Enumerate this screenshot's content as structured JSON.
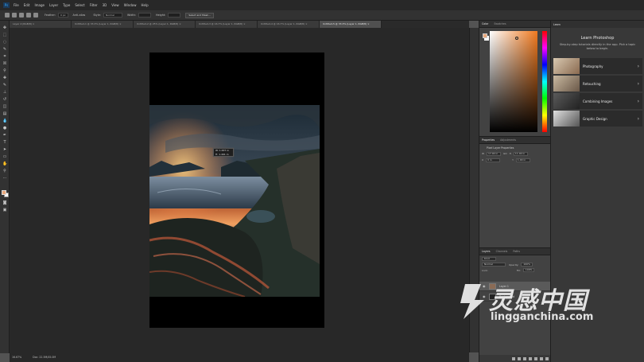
{
  "app": {
    "logo": "Ps"
  },
  "menu": [
    "File",
    "Edit",
    "Image",
    "Layer",
    "Type",
    "Select",
    "Filter",
    "3D",
    "View",
    "Window",
    "Help"
  ],
  "options": {
    "feather_label": "Feather:",
    "feather_value": "0 px",
    "antialias_label": "Anti-alias",
    "style_label": "Style:",
    "style_value": "Normal",
    "width_label": "Width:",
    "height_label": "Height:",
    "select_mask_button": "Select and Mask..."
  },
  "tabs": [
    "Layer 4 (RGB/8) ×",
    "Untitled-1 @ 33.3% (Layer 1, RGB/8) ×",
    "Untitled-2 @ 25% (Layer 1, RGB/8) ×",
    "Untitled-3 @ 16.7% (Layer 1, RGB/8) ×",
    "Untitled-4 @ 16.7% (Layer 1, RGB/8) ×",
    "Untitled-5 @ 33.3% (Layer 1, RGB/8) ×"
  ],
  "canvas": {
    "tip_w": "W: 1.637 in",
    "tip_h": "H: 1.491 in"
  },
  "status": {
    "zoom": "16.67%",
    "doc": "Doc: 22.5M/45.0M"
  },
  "color_panel": {
    "tabs": [
      "Color",
      "Swatches"
    ],
    "fg": "#e8a87c",
    "bg": "#ffffff"
  },
  "properties": {
    "tabs": [
      "Properties",
      "Adjustments"
    ],
    "title": "Pixel Layer Properties",
    "w_label": "W",
    "w_value": "17.00 in",
    "go_label": "GO",
    "h_label": "H",
    "h_value": "11.00 in",
    "x_label": "X",
    "x_value": "0 in",
    "y_label": "Y",
    "y_value": "1.00 in"
  },
  "layers": {
    "tabs": [
      "Layers",
      "Channels",
      "Paths"
    ],
    "kind": "Kind",
    "blend": "Normal",
    "opacity_label": "Opacity:",
    "opacity": "100%",
    "lock_label": "Lock:",
    "fill_label": "Fill:",
    "fill": "100%",
    "items": [
      {
        "name": "Layer 1"
      },
      {
        "name": "Background"
      }
    ]
  },
  "learn": {
    "tab": "Learn",
    "title": "Learn Photoshop",
    "subtitle": "Step-by-step tutorials directly in the app. Pick a topic below to begin.",
    "cards": [
      "Photography",
      "Retouching",
      "Combining Images",
      "Graphic Design"
    ]
  },
  "watermark": {
    "cn": "灵感中国",
    "en": "lingganchina.com"
  }
}
